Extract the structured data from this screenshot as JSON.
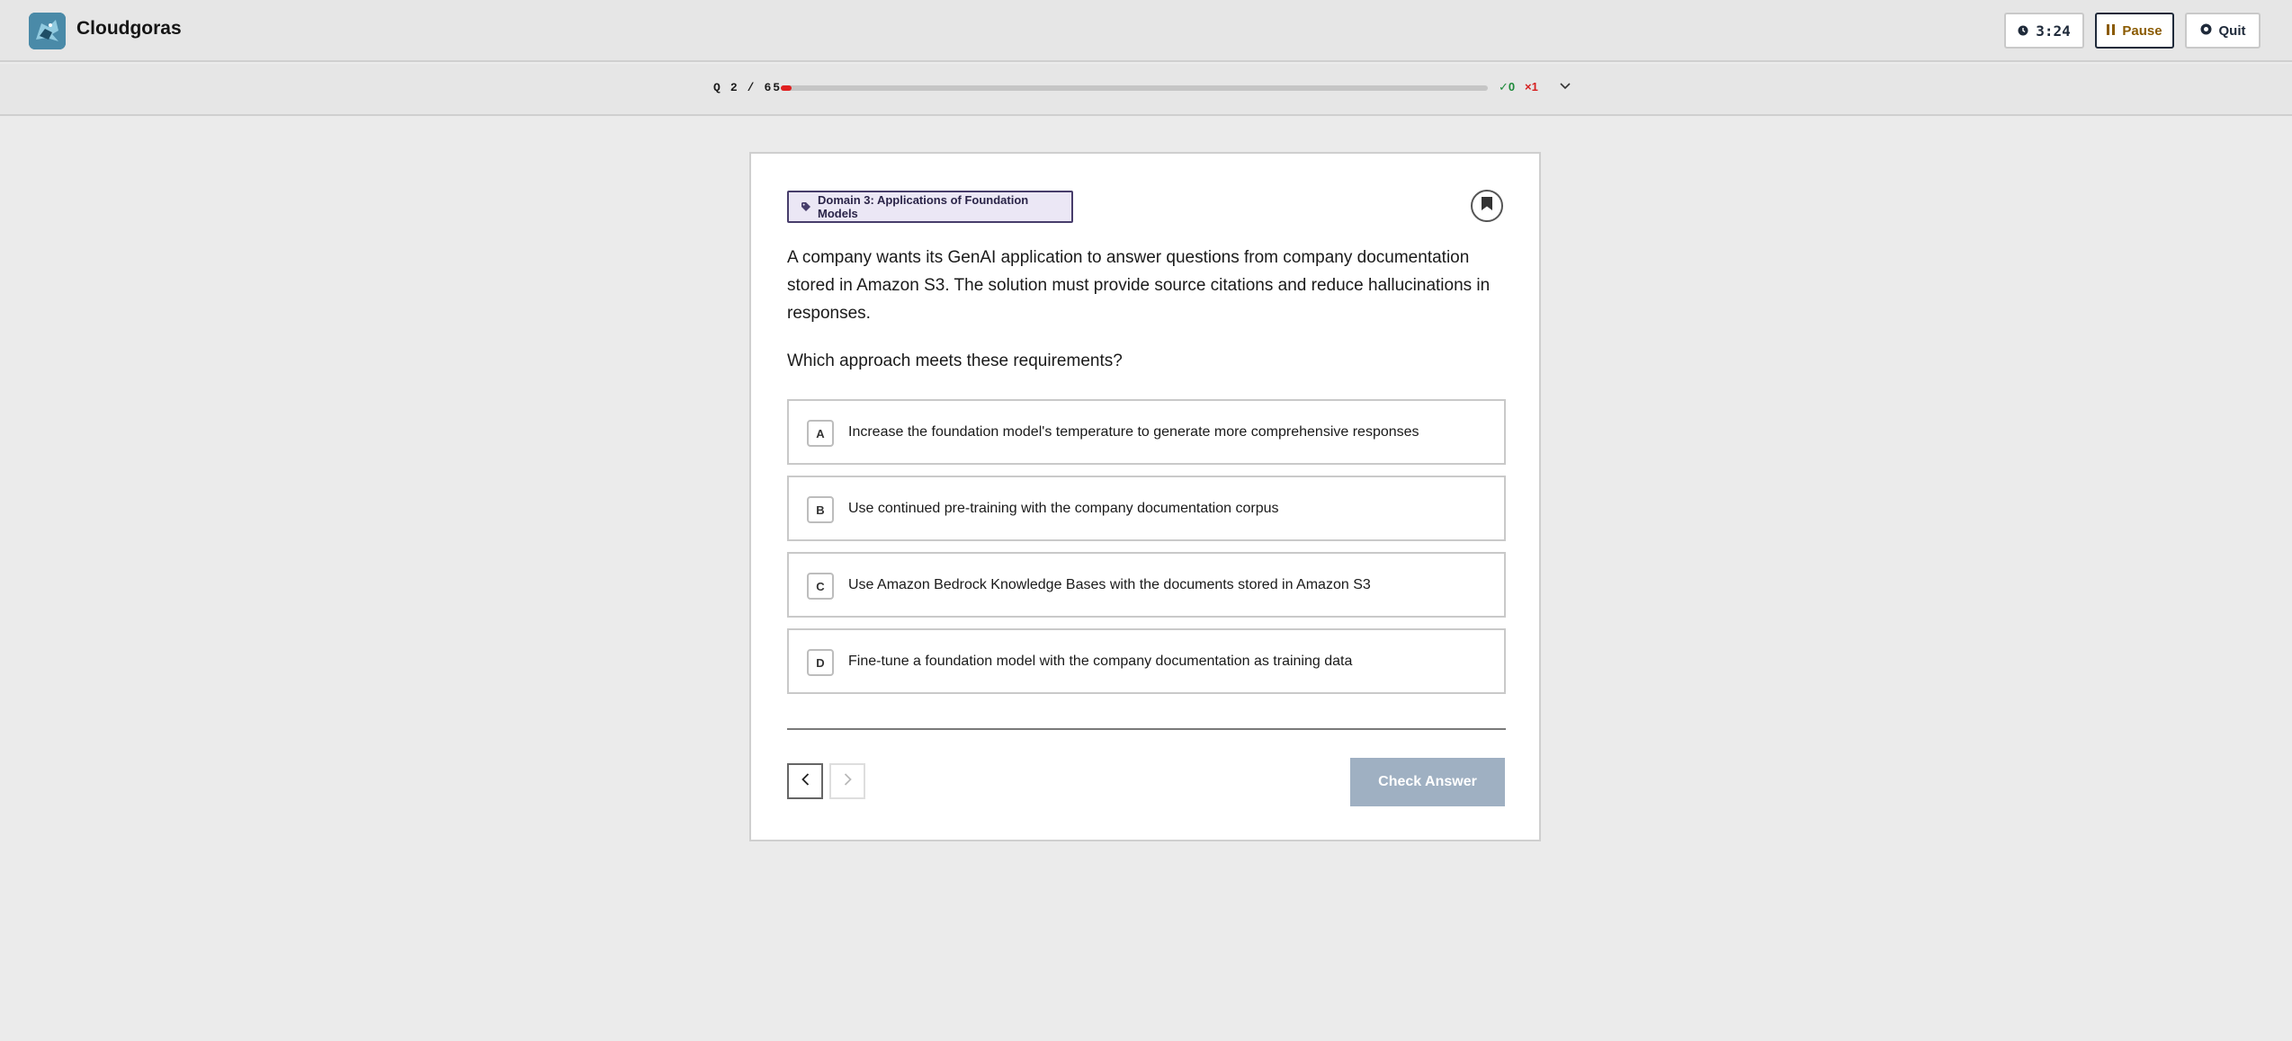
{
  "app": {
    "brand": "Cloudgoras"
  },
  "header": {
    "timer": "3:24",
    "pause_label": "Pause",
    "quit_label": "Quit"
  },
  "progress": {
    "q_label": "Q",
    "current": "2",
    "separator": "/",
    "total": "65",
    "fraction": 0.015,
    "correct_count": "0",
    "wrong_count": "1",
    "fill_color": "#e02020"
  },
  "question": {
    "domain_tag": "Domain 3: Applications of Foundation Models",
    "text": "A company wants its GenAI application to answer questions from company documentation stored in Amazon S3. The solution must provide source citations and reduce hallucinations in responses.",
    "prompt": "Which approach meets these requirements?",
    "options": [
      {
        "letter": "A",
        "text": "Increase the foundation model's temperature to generate more comprehensive responses"
      },
      {
        "letter": "B",
        "text": "Use continued pre-training with the company documentation corpus"
      },
      {
        "letter": "C",
        "text": "Use Amazon Bedrock Knowledge Bases with the documents stored in Amazon S3"
      },
      {
        "letter": "D",
        "text": "Fine-tune a foundation model with the company documentation as training data"
      }
    ]
  },
  "footer": {
    "check_label": "Check Answer"
  },
  "icons": {
    "logo": "cloudgoras-logo-icon",
    "timer": "clock-icon",
    "pause": "pause-icon",
    "quit": "circle-x-icon",
    "tag": "tag-icon",
    "bookmark": "bookmark-icon",
    "correct": "check-icon",
    "wrong": "x-icon",
    "expand": "chevron-down-icon",
    "prev": "chevron-left-icon",
    "next": "chevron-right-icon"
  }
}
